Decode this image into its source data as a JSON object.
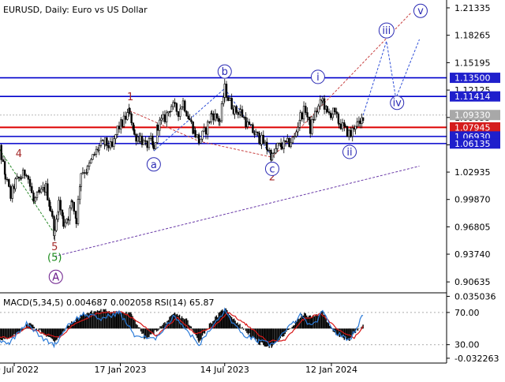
{
  "title": "EURUSD, Daily:  Euro vs US Dollar",
  "colors": {
    "background": "#ffffff",
    "axis": "#000000",
    "grid": "#c8c8c8",
    "candle": "#000000",
    "blue_level": "#0000cc",
    "red_level": "#dd0000",
    "label_blue_bg": "#1f1fcc",
    "label_red_bg": "#d51c1c",
    "label_gray_bg": "#a8a8a8",
    "wave_label_blue": "#2a2ab4",
    "wave_label_red": "#a52a2a",
    "wave_label_green": "#1a8a1a",
    "wave_label_purple": "#6a1a8a",
    "dash_red": "#c84040",
    "dash_blue": "#3050d8",
    "dash_purple": "#6a3aa8",
    "dash_green": "#2a8a2a",
    "macd_hist": "#000000",
    "macd_signal": "#d81818",
    "rsi": "#2a7ad8"
  },
  "chart_data": [
    {
      "type": "line",
      "name": "price_panel",
      "title": "EURUSD, Daily:  Euro vs US Dollar",
      "ylim": [
        0.895,
        1.2195
      ],
      "y_ticks": [
        "1.21335",
        "1.18265",
        "1.15195",
        "1.12125",
        "1.09055",
        "1.05985",
        "1.02935",
        "0.99870",
        "0.96805",
        "0.93740",
        "0.90635"
      ],
      "y_tick_values": [
        1.21335,
        1.18265,
        1.15195,
        1.12125,
        1.09055,
        1.05985,
        1.02935,
        0.9987,
        0.96805,
        0.9374,
        0.90635
      ],
      "x_ticks": [
        "20 Jul 2022",
        "17 Jan 2023",
        "14 Jul 2023",
        "12 Jan 2024"
      ],
      "x_tick_dates": [
        "2022-07-20",
        "2023-01-17",
        "2023-07-14",
        "2024-01-12"
      ],
      "price_labels": [
        {
          "text": "1.13500",
          "value": 1.135,
          "style": "blue"
        },
        {
          "text": "1.11414",
          "value": 1.11414,
          "style": "blue"
        },
        {
          "text": "1.09330",
          "value": 1.0933,
          "style": "gray"
        },
        {
          "text": "1.07945",
          "value": 1.07945,
          "style": "red"
        },
        {
          "text": "1.06930",
          "value": 1.0693,
          "style": "blue"
        },
        {
          "text": "1.06135",
          "value": 1.06135,
          "style": "blue"
        }
      ],
      "levels": [
        {
          "value": 1.135,
          "color": "blue_level"
        },
        {
          "value": 1.11414,
          "color": "blue_level"
        },
        {
          "value": 1.07945,
          "color": "red_level"
        },
        {
          "value": 1.0693,
          "color": "blue_level"
        },
        {
          "value": 1.06135,
          "color": "blue_level"
        }
      ],
      "price_path": [
        [
          "2022-06-15",
          1.044
        ],
        [
          "2022-06-25",
          1.056
        ],
        [
          "2022-07-05",
          1.024
        ],
        [
          "2022-07-14",
          1.002
        ],
        [
          "2022-07-22",
          1.018
        ],
        [
          "2022-08-01",
          1.024
        ],
        [
          "2022-08-10",
          1.031
        ],
        [
          "2022-08-22",
          0.996
        ],
        [
          "2022-09-01",
          1.005
        ],
        [
          "2022-09-12",
          1.012
        ],
        [
          "2022-09-20",
          0.988
        ],
        [
          "2022-09-27",
          0.96
        ],
        [
          "2022-10-04",
          0.996
        ],
        [
          "2022-10-12",
          0.972
        ],
        [
          "2022-10-20",
          0.98
        ],
        [
          "2022-10-27",
          0.996
        ],
        [
          "2022-11-03",
          0.976
        ],
        [
          "2022-11-11",
          1.03
        ],
        [
          "2022-11-22",
          1.032
        ],
        [
          "2022-12-01",
          1.046
        ],
        [
          "2022-12-12",
          1.058
        ],
        [
          "2022-12-22",
          1.062
        ],
        [
          "2023-01-03",
          1.056
        ],
        [
          "2023-01-12",
          1.078
        ],
        [
          "2023-01-20",
          1.084
        ],
        [
          "2023-02-02",
          1.098
        ],
        [
          "2023-02-10",
          1.07
        ],
        [
          "2023-02-20",
          1.068
        ],
        [
          "2023-03-01",
          1.058
        ],
        [
          "2023-03-10",
          1.064
        ],
        [
          "2023-03-15",
          1.053
        ],
        [
          "2023-03-22",
          1.082
        ],
        [
          "2023-04-03",
          1.09
        ],
        [
          "2023-04-14",
          1.104
        ],
        [
          "2023-04-26",
          1.097
        ],
        [
          "2023-05-04",
          1.108
        ],
        [
          "2023-05-15",
          1.088
        ],
        [
          "2023-05-25",
          1.072
        ],
        [
          "2023-05-31",
          1.064
        ],
        [
          "2023-06-12",
          1.077
        ],
        [
          "2023-06-22",
          1.095
        ],
        [
          "2023-07-06",
          1.087
        ],
        [
          "2023-07-14",
          1.123
        ],
        [
          "2023-07-20",
          1.112
        ],
        [
          "2023-07-31",
          1.098
        ],
        [
          "2023-08-10",
          1.097
        ],
        [
          "2023-08-22",
          1.082
        ],
        [
          "2023-09-05",
          1.071
        ],
        [
          "2023-09-15",
          1.065
        ],
        [
          "2023-09-25",
          1.056
        ],
        [
          "2023-10-03",
          1.046
        ],
        [
          "2023-10-12",
          1.058
        ],
        [
          "2023-10-20",
          1.059
        ],
        [
          "2023-11-01",
          1.062
        ],
        [
          "2023-11-10",
          1.068
        ],
        [
          "2023-11-20",
          1.092
        ],
        [
          "2023-11-29",
          1.1
        ],
        [
          "2023-12-07",
          1.077
        ],
        [
          "2023-12-15",
          1.095
        ],
        [
          "2023-12-28",
          1.11
        ],
        [
          "2024-01-05",
          1.094
        ],
        [
          "2024-01-15",
          1.096
        ],
        [
          "2024-01-25",
          1.085
        ],
        [
          "2024-02-05",
          1.076
        ],
        [
          "2024-02-14",
          1.071
        ],
        [
          "2024-02-22",
          1.084
        ],
        [
          "2024-03-01",
          1.081
        ],
        [
          "2024-03-06",
          1.093
        ]
      ],
      "wave_lines": [
        {
          "points": [
            [
              "2023-02-02",
              1.098
            ],
            [
              "2023-05-31",
              1.064
            ]
          ],
          "color": "dash_red"
        },
        {
          "points": [
            [
              "2023-05-31",
              1.064
            ],
            [
              "2023-10-03",
              1.046
            ]
          ],
          "color": "dash_red"
        },
        {
          "points": [
            [
              "2023-10-03",
              1.046
            ],
            [
              "2024-05-27",
              1.208
            ]
          ],
          "color": "dash_red"
        },
        {
          "points": [
            [
              "2023-03-15",
              1.053
            ],
            [
              "2023-07-14",
              1.123
            ],
            [
              "2023-10-03",
              1.046
            ]
          ],
          "color": "dash_blue"
        },
        {
          "points": [
            [
              "2024-03-06",
              1.093
            ],
            [
              "2024-04-15",
              1.176
            ],
            [
              "2024-05-01",
              1.112
            ],
            [
              "2024-06-10",
              1.178
            ]
          ],
          "color": "dash_blue"
        },
        {
          "points": [
            [
              "2022-09-27",
              0.935
            ],
            [
              "2024-06-10",
              1.036
            ]
          ],
          "color": "dash_purple"
        },
        {
          "points": [
            [
              "2022-06-10",
              1.07
            ],
            [
              "2022-09-27",
              0.96
            ]
          ],
          "color": "dash_green"
        }
      ],
      "wave_labels": [
        {
          "text": "4",
          "x": "2022-07-28",
          "y": 1.05,
          "style": "plain",
          "color": "wave_label_red"
        },
        {
          "text": "5",
          "x": "2022-09-27",
          "y": 0.946,
          "style": "plain",
          "color": "wave_label_red"
        },
        {
          "text": "(5)",
          "x": "2022-09-27",
          "y": 0.934,
          "style": "plain",
          "color": "wave_label_green"
        },
        {
          "text": "A",
          "x": "2022-09-29",
          "y": 0.912,
          "style": "circle",
          "color": "wave_label_purple"
        },
        {
          "text": "1",
          "x": "2023-02-03",
          "y": 1.114,
          "style": "plain",
          "color": "wave_label_red"
        },
        {
          "text": "2",
          "x": "2023-10-03",
          "y": 1.024,
          "style": "plain",
          "color": "wave_label_red"
        },
        {
          "text": "a",
          "x": "2023-03-15",
          "y": 1.038,
          "style": "circle",
          "color": "wave_label_blue"
        },
        {
          "text": "b",
          "x": "2023-07-14",
          "y": 1.142,
          "style": "circle",
          "color": "wave_label_blue"
        },
        {
          "text": "c",
          "x": "2023-10-03",
          "y": 1.033,
          "style": "circle",
          "color": "wave_label_blue"
        },
        {
          "text": "i",
          "x": "2023-12-20",
          "y": 1.136,
          "style": "circle",
          "color": "wave_label_blue"
        },
        {
          "text": "ii",
          "x": "2024-02-12",
          "y": 1.052,
          "style": "circle",
          "color": "wave_label_blue"
        },
        {
          "text": "iii",
          "x": "2024-04-15",
          "y": 1.188,
          "style": "circle",
          "color": "wave_label_blue"
        },
        {
          "text": "iv",
          "x": "2024-05-03",
          "y": 1.107,
          "style": "circle",
          "color": "wave_label_blue"
        },
        {
          "text": "v",
          "x": "2024-06-12",
          "y": 1.21,
          "style": "circle",
          "color": "wave_label_blue"
        }
      ],
      "grid": false
    },
    {
      "type": "bar",
      "name": "indicator_panel",
      "title": "MACD(5,34,5) 0.004687 0.002058 RSI(14) 65.87",
      "ylim": [
        -0.0375,
        0.038
      ],
      "y_ticks": [
        "0.035036",
        "70.00",
        "30.00",
        "-0.032263"
      ],
      "y_tick_values": [
        0.035036,
        0.0175,
        -0.0175,
        -0.032263
      ],
      "guide_values": [
        0.0175,
        -0.0175
      ],
      "macd_path": [
        [
          "2022-06-10",
          -0.01
        ],
        [
          "2022-07-10",
          -0.012
        ],
        [
          "2022-07-25",
          -0.006
        ],
        [
          "2022-08-15",
          0.006
        ],
        [
          "2022-09-05",
          -0.004
        ],
        [
          "2022-09-27",
          -0.014
        ],
        [
          "2022-10-20",
          0.003
        ],
        [
          "2022-11-15",
          0.016
        ],
        [
          "2022-12-15",
          0.02
        ],
        [
          "2023-01-15",
          0.018
        ],
        [
          "2023-02-05",
          0.016
        ],
        [
          "2023-03-01",
          -0.012
        ],
        [
          "2023-03-20",
          -0.002
        ],
        [
          "2023-04-20",
          0.016
        ],
        [
          "2023-05-10",
          0.01
        ],
        [
          "2023-05-31",
          -0.014
        ],
        [
          "2023-06-20",
          0.006
        ],
        [
          "2023-07-14",
          0.022
        ],
        [
          "2023-08-05",
          0.006
        ],
        [
          "2023-09-10",
          -0.016
        ],
        [
          "2023-10-03",
          -0.02
        ],
        [
          "2023-10-25",
          -0.006
        ],
        [
          "2023-11-25",
          0.016
        ],
        [
          "2023-12-10",
          0.012
        ],
        [
          "2023-12-28",
          0.018
        ],
        [
          "2024-01-20",
          -0.008
        ],
        [
          "2024-02-12",
          -0.012
        ],
        [
          "2024-03-01",
          0.002
        ],
        [
          "2024-03-06",
          0.005
        ]
      ],
      "signal_path": [
        [
          "2022-06-10",
          -0.008
        ],
        [
          "2022-07-15",
          -0.01
        ],
        [
          "2022-08-10",
          0.002
        ],
        [
          "2022-09-10",
          -0.006
        ],
        [
          "2022-10-05",
          -0.01
        ],
        [
          "2022-11-01",
          0.006
        ],
        [
          "2022-12-10",
          0.017
        ],
        [
          "2023-01-20",
          0.018
        ],
        [
          "2023-02-20",
          0.006
        ],
        [
          "2023-03-20",
          -0.008
        ],
        [
          "2023-04-25",
          0.012
        ],
        [
          "2023-05-25",
          -0.006
        ],
        [
          "2023-06-25",
          0.002
        ],
        [
          "2023-07-20",
          0.018
        ],
        [
          "2023-08-20",
          0.004
        ],
        [
          "2023-09-25",
          -0.014
        ],
        [
          "2023-10-25",
          -0.012
        ],
        [
          "2023-11-25",
          0.01
        ],
        [
          "2023-12-25",
          0.016
        ],
        [
          "2024-01-25",
          -0.002
        ],
        [
          "2024-02-20",
          -0.01
        ],
        [
          "2024-03-06",
          0.002
        ]
      ],
      "rsi_path": [
        [
          "2022-06-10",
          40
        ],
        [
          "2022-07-12",
          32
        ],
        [
          "2022-08-10",
          58
        ],
        [
          "2022-09-05",
          38
        ],
        [
          "2022-09-27",
          30
        ],
        [
          "2022-10-20",
          55
        ],
        [
          "2022-11-15",
          68
        ],
        [
          "2022-12-15",
          62
        ],
        [
          "2023-01-15",
          70
        ],
        [
          "2023-02-10",
          42
        ],
        [
          "2023-03-15",
          36
        ],
        [
          "2023-04-20",
          66
        ],
        [
          "2023-05-31",
          30
        ],
        [
          "2023-07-14",
          72
        ],
        [
          "2023-08-10",
          44
        ],
        [
          "2023-09-10",
          34
        ],
        [
          "2023-10-03",
          30
        ],
        [
          "2023-11-20",
          66
        ],
        [
          "2023-12-10",
          52
        ],
        [
          "2023-12-28",
          70
        ],
        [
          "2024-01-20",
          44
        ],
        [
          "2024-02-12",
          36
        ],
        [
          "2024-03-06",
          66
        ]
      ],
      "grid": false
    }
  ]
}
